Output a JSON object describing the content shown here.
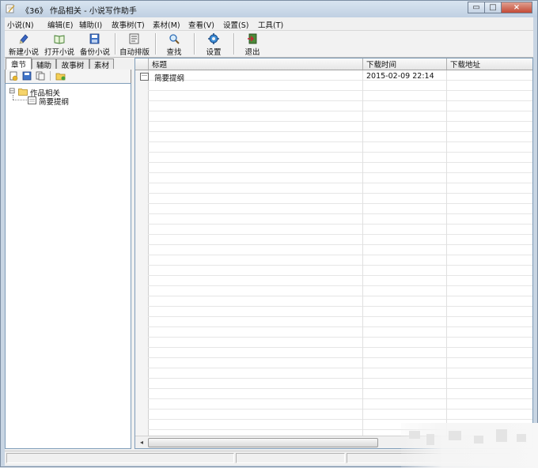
{
  "window": {
    "title": "《36》 作品相关 - 小说写作助手",
    "controls": {
      "minimize": "▭",
      "maximize": "□",
      "close": "×"
    }
  },
  "menu": [
    {
      "label": "小说(N)"
    },
    {
      "label": "编辑(E)"
    },
    {
      "label": "辅助(I)"
    },
    {
      "label": "故事树(T)"
    },
    {
      "label": "素材(M)"
    },
    {
      "label": "查看(V)"
    },
    {
      "label": "设置(S)"
    },
    {
      "label": "工具(T)"
    }
  ],
  "toolbar": [
    {
      "label": "新建小说",
      "icon": "new-novel-icon"
    },
    {
      "label": "打开小说",
      "icon": "open-book-icon"
    },
    {
      "label": "备份小说",
      "icon": "save-disk-icon"
    },
    {
      "label": "自动排版",
      "icon": "auto-layout-icon"
    },
    {
      "label": "查找",
      "icon": "magnifier-icon"
    },
    {
      "label": "设置",
      "icon": "gear-icon"
    },
    {
      "label": "退出",
      "icon": "exit-door-icon"
    }
  ],
  "left_tabs": [
    {
      "label": "章节",
      "active": true
    },
    {
      "label": "辅助",
      "active": false
    },
    {
      "label": "故事树",
      "active": false
    },
    {
      "label": "素材",
      "active": false
    }
  ],
  "tree_tools": [
    "new-file-icon",
    "save-icon",
    "copy-page-icon",
    "folder-add-icon"
  ],
  "tree": {
    "root": {
      "label": "作品相关",
      "expander": "⊟",
      "icon": "folder-icon"
    },
    "children": [
      {
        "label": "简要提纲",
        "icon": "document-icon"
      }
    ]
  },
  "table": {
    "columns": [
      {
        "label": "标题"
      },
      {
        "label": "下载时间"
      },
      {
        "label": "下载地址"
      }
    ],
    "rows": [
      {
        "title": "简要提纲",
        "download_time": "2015-02-09 22:14",
        "download_url": ""
      }
    ]
  },
  "colors": {
    "titlebar": "#c8d5e3",
    "close_button": "#c44a36",
    "grid_line": "#e6e6e6",
    "border": "#7f9db9"
  }
}
